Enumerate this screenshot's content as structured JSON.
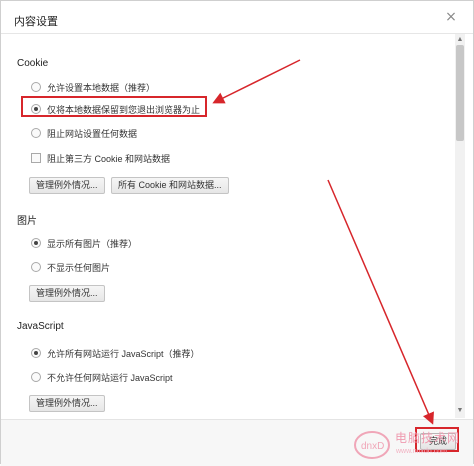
{
  "dialog": {
    "title": "内容设置",
    "close_glyph": "×"
  },
  "cookie": {
    "heading": "Cookie",
    "options": [
      {
        "label": "允许设置本地数据（推荐）",
        "checked": false
      },
      {
        "label": "仅将本地数据保留到您退出浏览器为止",
        "checked": true
      },
      {
        "label": "阻止网站设置任何数据",
        "checked": false
      }
    ],
    "block_third_party": {
      "label": "阻止第三方 Cookie 和网站数据",
      "checked": false
    },
    "manage_exceptions_label": "管理例外情况...",
    "all_cookies_label": "所有 Cookie 和网站数据..."
  },
  "images": {
    "heading": "图片",
    "options": [
      {
        "label": "显示所有图片（推荐）",
        "checked": true
      },
      {
        "label": "不显示任何图片",
        "checked": false
      }
    ],
    "manage_exceptions_label": "管理例外情况..."
  },
  "javascript": {
    "heading": "JavaScript",
    "options": [
      {
        "label": "允许所有网站运行 JavaScript（推荐）",
        "checked": true
      },
      {
        "label": "不允许任何网站运行 JavaScript",
        "checked": false
      }
    ],
    "manage_exceptions_label": "管理例外情况..."
  },
  "footer": {
    "done_label": "完成"
  },
  "watermark": {
    "text": "电脑技术网",
    "url": "www.nnxdn.com"
  },
  "colors": {
    "annotation_red": "#d7262b"
  },
  "icons": {
    "close": "close-icon",
    "scroll_up": "scroll-up-arrow-icon",
    "scroll_down": "scroll-down-arrow-icon",
    "watermark_logo": "watermark-logo-icon"
  }
}
